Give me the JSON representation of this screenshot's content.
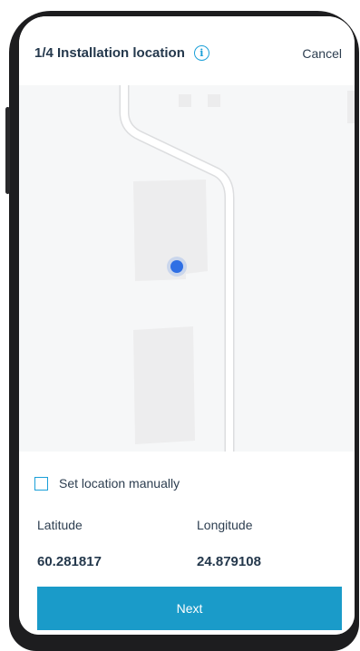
{
  "header": {
    "title": "1/4 Installation location",
    "info_icon": "info-icon",
    "cancel_label": "Cancel"
  },
  "map": {
    "location_marker_icon": "location-dot-icon",
    "marker_color": "#2f6fe4"
  },
  "manual": {
    "checkbox_label": "Set location manually",
    "checked": false
  },
  "coordinates": {
    "latitude_label": "Latitude",
    "latitude_value": "60.281817",
    "longitude_label": "Longitude",
    "longitude_value": "24.879108"
  },
  "footer": {
    "next_label": "Next"
  },
  "colors": {
    "accent": "#1a9bc9",
    "title_text": "#24384c"
  }
}
